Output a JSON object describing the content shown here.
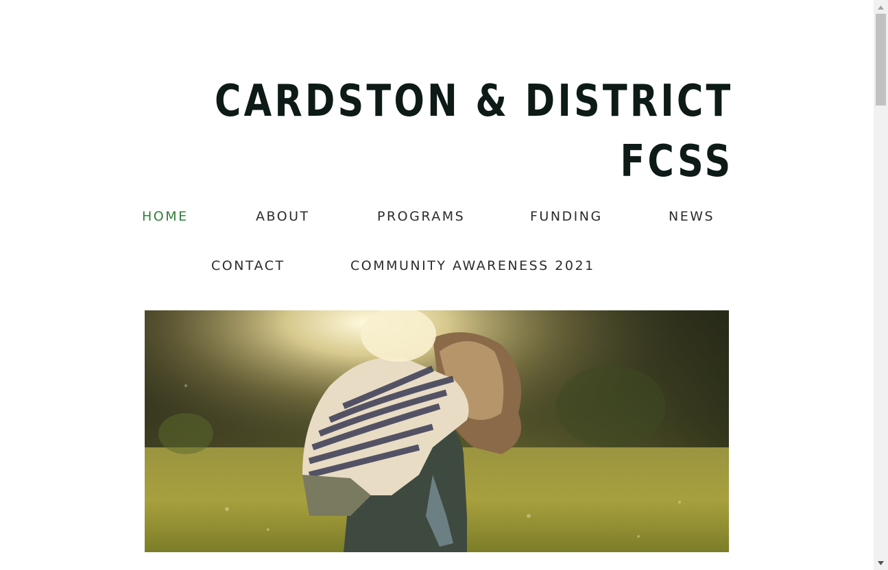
{
  "site": {
    "title_line1": "CARDSTON & DISTRICT",
    "title_line2": "FCSS"
  },
  "nav": {
    "items": [
      {
        "label": "HOME",
        "active": true
      },
      {
        "label": "ABOUT",
        "active": false
      },
      {
        "label": "PROGRAMS",
        "active": false
      },
      {
        "label": "FUNDING",
        "active": false
      },
      {
        "label": "NEWS",
        "active": false
      },
      {
        "label": "CONTACT",
        "active": false
      },
      {
        "label": "COMMUNITY AWARENESS 2021",
        "active": false
      }
    ]
  },
  "hero": {
    "image": "children-piggyback-sunlit-meadow"
  },
  "colors": {
    "title": "#0d1a17",
    "nav_text": "#2b2b2b",
    "nav_active": "#2e7d3a",
    "background": "#ffffff"
  }
}
